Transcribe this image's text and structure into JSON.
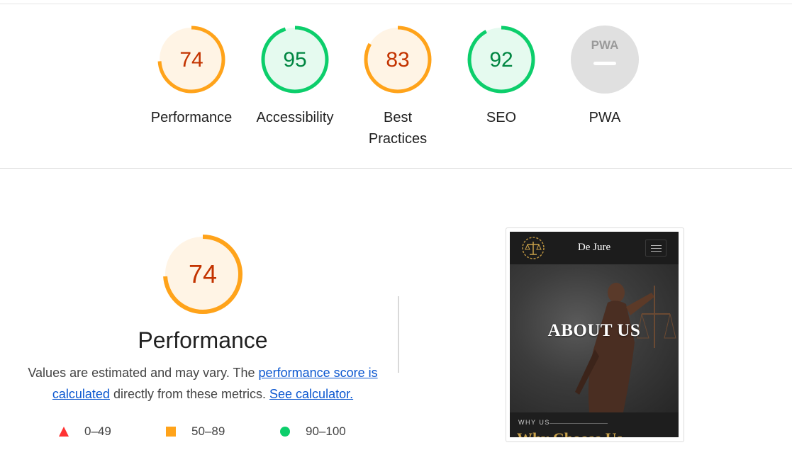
{
  "colors": {
    "average_stroke": "#ffa31a",
    "average_fill": "#fff4e5",
    "average_text": "#c33300",
    "pass_stroke": "#0cce6b",
    "pass_fill": "#e5faef",
    "pass_text": "#018642",
    "fail_color": "#ff3333",
    "na_fill": "#e0e0e0",
    "link_color": "#0b57d0"
  },
  "summary": {
    "gauges": [
      {
        "id": "performance",
        "score": "74",
        "score_value": 74,
        "label": "Performance",
        "rating": "average"
      },
      {
        "id": "accessibility",
        "score": "95",
        "score_value": 95,
        "label": "Accessibility",
        "rating": "pass"
      },
      {
        "id": "best-practices",
        "score": "83",
        "score_value": 83,
        "label_line1": "Best",
        "label_line2": "Practices",
        "rating": "average"
      },
      {
        "id": "seo",
        "score": "92",
        "score_value": 92,
        "label": "SEO",
        "rating": "pass"
      },
      {
        "id": "pwa",
        "badge_text": "PWA",
        "label": "PWA",
        "rating": "na"
      }
    ]
  },
  "performance_section": {
    "score": "74",
    "score_value": 74,
    "title": "Performance",
    "desc_part1": "Values are estimated and may vary. The ",
    "desc_link1": "performance score is calculated",
    "desc_part2": " directly from these metrics. ",
    "desc_link2": "See calculator."
  },
  "legend": [
    {
      "shape": "triangle",
      "range": "0–49",
      "rating": "fail"
    },
    {
      "shape": "square",
      "range": "50–89",
      "rating": "average"
    },
    {
      "shape": "circle",
      "range": "90–100",
      "rating": "pass"
    }
  ],
  "screenshot": {
    "brand": "De Jure",
    "hero_title": "ABOUT US",
    "section_kicker": "WHY US",
    "section_heading": "Why Choose Us"
  }
}
